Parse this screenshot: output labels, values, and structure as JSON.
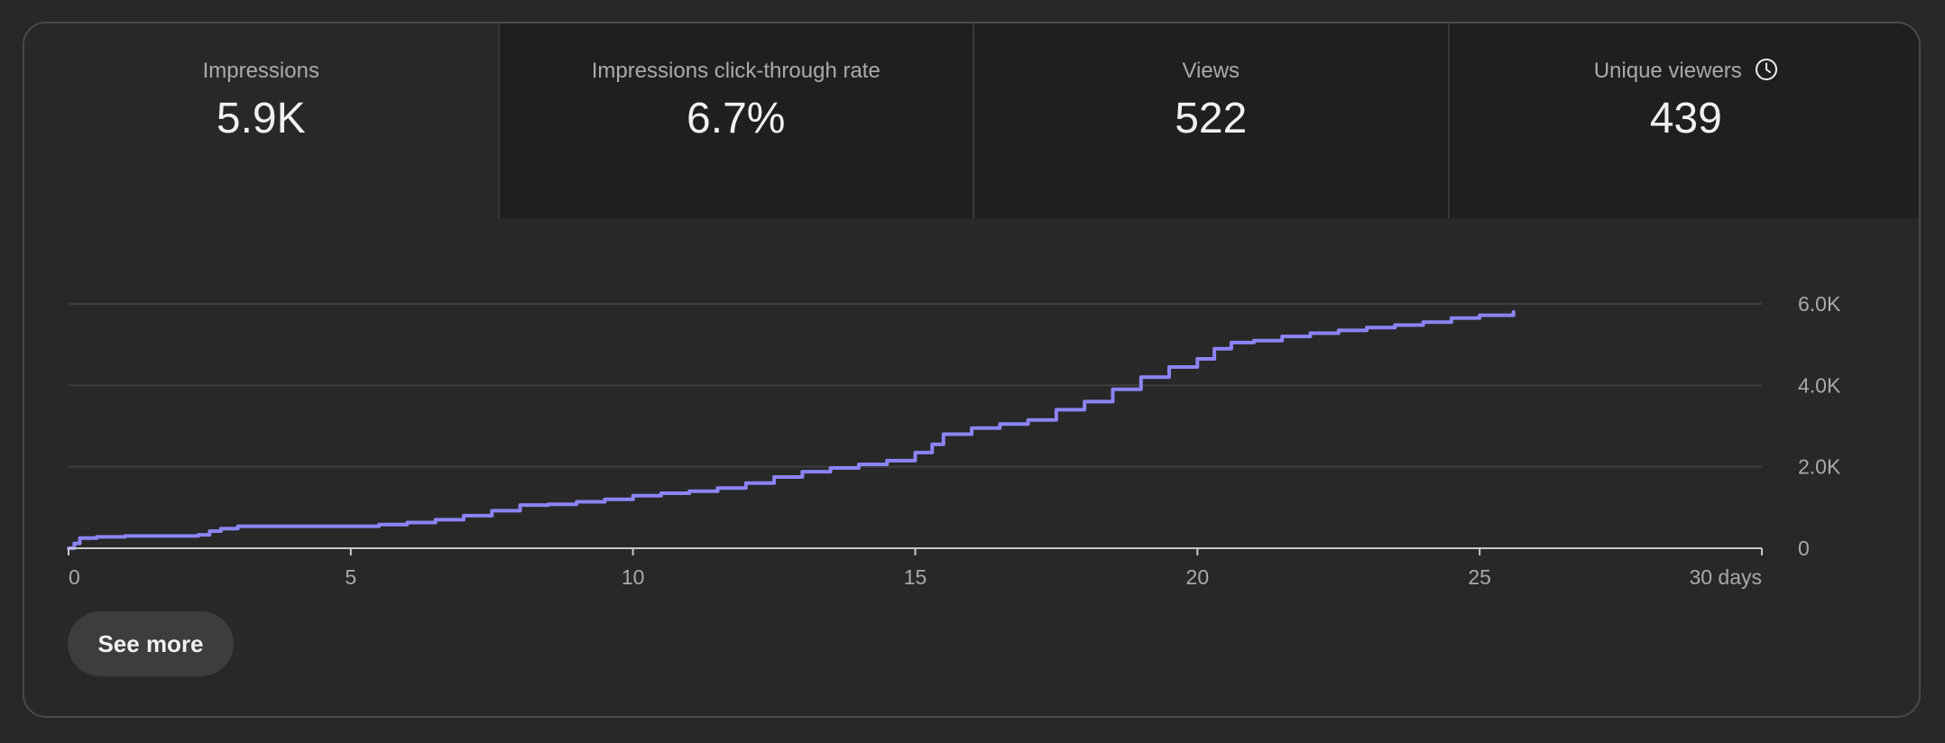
{
  "tabs": [
    {
      "label": "Impressions",
      "value": "5.9K",
      "active": true
    },
    {
      "label": "Impressions click-through rate",
      "value": "6.7%",
      "active": false
    },
    {
      "label": "Views",
      "value": "522",
      "active": false
    },
    {
      "label": "Unique viewers",
      "value": "439",
      "active": false,
      "icon": "clock-icon"
    }
  ],
  "see_more_label": "See more",
  "colors": {
    "line": "#8b84f4",
    "grid": "#3f3f3f",
    "axis": "#c8c8c8",
    "tick_text": "#aaaaaa"
  },
  "chart_data": {
    "type": "line",
    "title": "",
    "xlabel": "",
    "ylabel": "",
    "xlim": [
      0,
      30
    ],
    "ylim": [
      0,
      6000
    ],
    "x_ticks": [
      0,
      5,
      10,
      15,
      20,
      25,
      30
    ],
    "x_tick_labels": [
      "0",
      "5",
      "10",
      "15",
      "20",
      "25",
      "30 days"
    ],
    "y_ticks": [
      0,
      2000,
      4000,
      6000
    ],
    "y_tick_labels": [
      "0",
      "2.0K",
      "4.0K",
      "6.0K"
    ],
    "y_axis_position": "right",
    "grid": true,
    "series": [
      {
        "values": [
          [
            0,
            0
          ],
          [
            0.1,
            120
          ],
          [
            0.2,
            250
          ],
          [
            0.5,
            280
          ],
          [
            1,
            300
          ],
          [
            1.5,
            300
          ],
          [
            2.1,
            300
          ],
          [
            2.3,
            330
          ],
          [
            2.5,
            420
          ],
          [
            2.7,
            480
          ],
          [
            3,
            540
          ],
          [
            4,
            540
          ],
          [
            5,
            540
          ],
          [
            5.5,
            580
          ],
          [
            6,
            630
          ],
          [
            6.5,
            700
          ],
          [
            7,
            800
          ],
          [
            7.5,
            920
          ],
          [
            8,
            1060
          ],
          [
            8.5,
            1080
          ],
          [
            9,
            1140
          ],
          [
            9.5,
            1200
          ],
          [
            10,
            1290
          ],
          [
            10.5,
            1350
          ],
          [
            11,
            1400
          ],
          [
            11.5,
            1480
          ],
          [
            12,
            1600
          ],
          [
            12.5,
            1750
          ],
          [
            13,
            1880
          ],
          [
            13.5,
            1970
          ],
          [
            14,
            2060
          ],
          [
            14.5,
            2150
          ],
          [
            15,
            2350
          ],
          [
            15.3,
            2550
          ],
          [
            15.5,
            2800
          ],
          [
            16,
            2950
          ],
          [
            16.5,
            3050
          ],
          [
            17,
            3150
          ],
          [
            17.5,
            3400
          ],
          [
            18,
            3600
          ],
          [
            18.5,
            3900
          ],
          [
            19,
            4200
          ],
          [
            19.5,
            4450
          ],
          [
            20,
            4650
          ],
          [
            20.3,
            4900
          ],
          [
            20.6,
            5050
          ],
          [
            21,
            5100
          ],
          [
            21.5,
            5200
          ],
          [
            22,
            5280
          ],
          [
            22.5,
            5350
          ],
          [
            23,
            5420
          ],
          [
            23.5,
            5480
          ],
          [
            24,
            5550
          ],
          [
            24.5,
            5650
          ],
          [
            25,
            5720
          ],
          [
            25.6,
            5800
          ]
        ]
      }
    ]
  }
}
